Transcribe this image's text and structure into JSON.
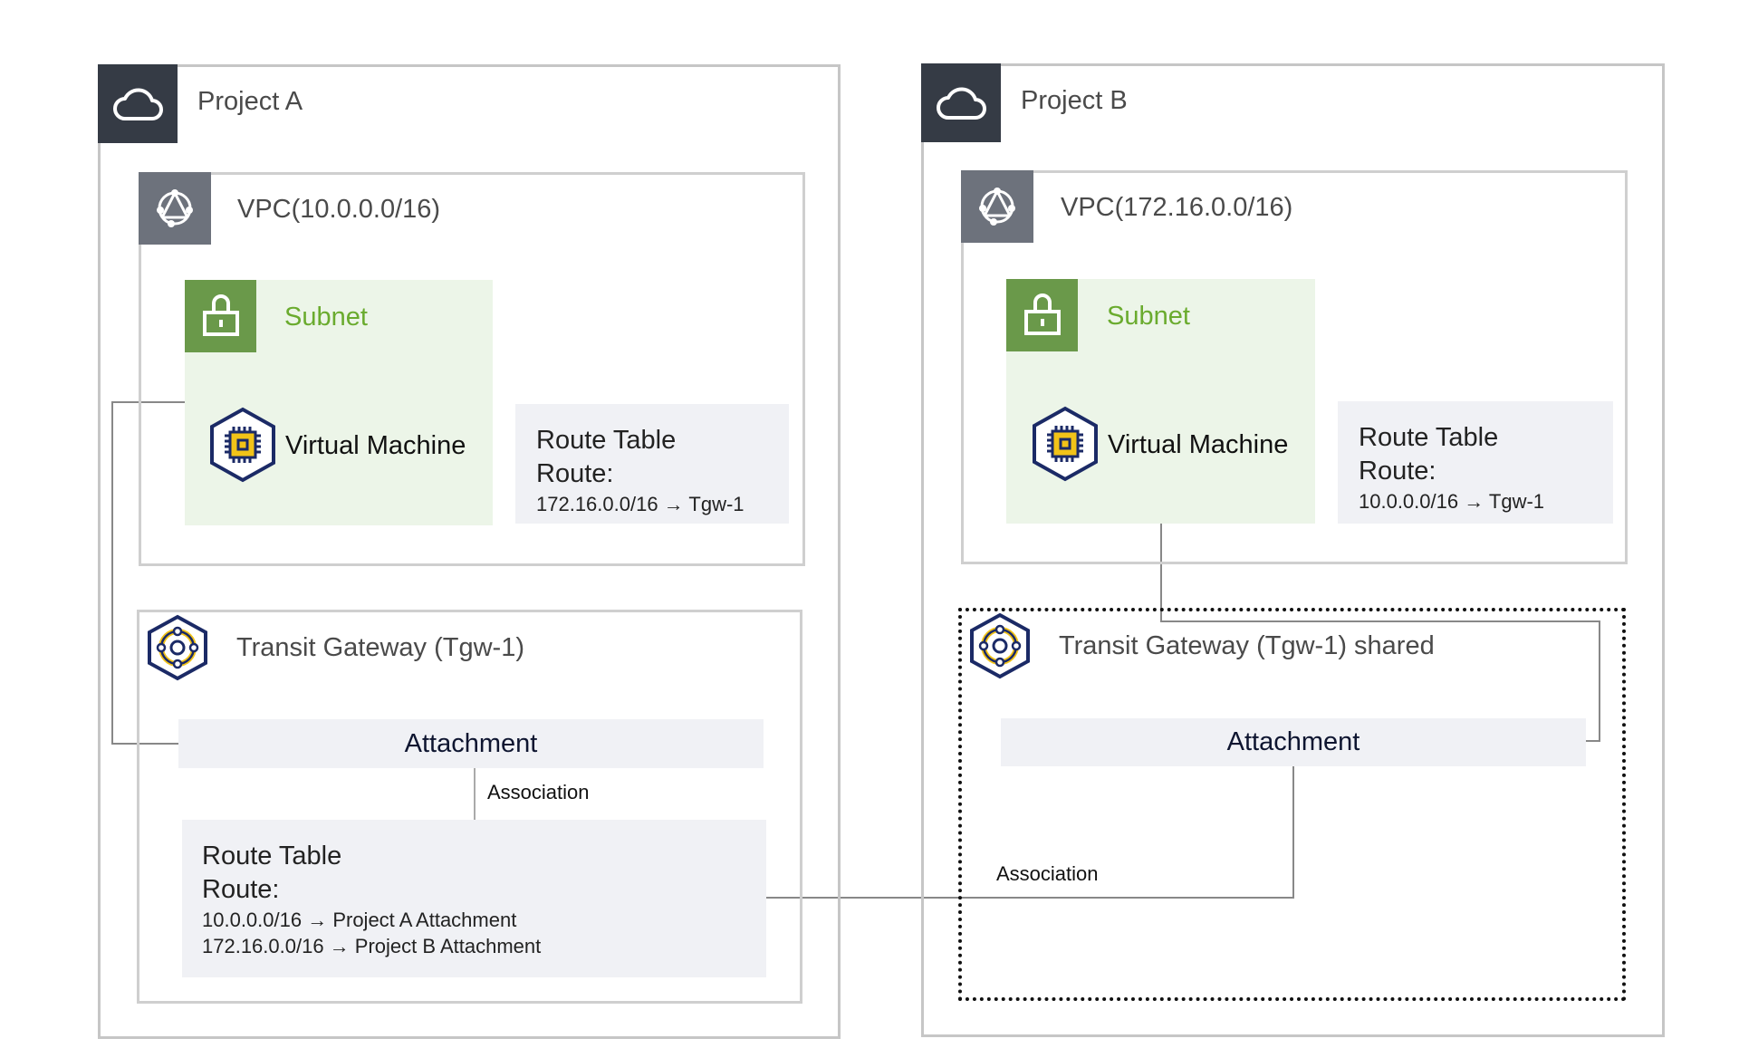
{
  "colors": {
    "header_dark": "#353b45",
    "vpc_icon_bg": "#6d727c",
    "subnet_green": "#6a994a",
    "subnet_bg": "#ecf5e8",
    "panel_bg": "#f0f1f5",
    "icon_navy": "#1b2a66",
    "icon_yellow": "#f2c318"
  },
  "project_a": {
    "title": "Project A",
    "icon": "cloud-icon",
    "vpc": {
      "title": "VPC(10.0.0.0/16)",
      "icon": "vpc-network-icon",
      "subnet": {
        "title": "Subnet",
        "icon": "lock-icon",
        "vm": {
          "label": "Virtual Machine",
          "icon": "cpu-chip-icon"
        }
      },
      "route_table": {
        "title": "Route Table",
        "route_label": "Route:",
        "routes": [
          "172.16.0.0/16 → Tgw-1"
        ]
      }
    },
    "tgw": {
      "title": "Transit Gateway (Tgw-1)",
      "icon": "transit-gateway-icon",
      "attachment": "Attachment",
      "association": "Association",
      "route_table": {
        "title": "Route Table",
        "route_label": "Route:",
        "routes": [
          "10.0.0.0/16 → Project A Attachment",
          "172.16.0.0/16 → Project B Attachment"
        ]
      }
    }
  },
  "project_b": {
    "title": "Project B",
    "icon": "cloud-icon",
    "vpc": {
      "title": "VPC(172.16.0.0/16)",
      "icon": "vpc-network-icon",
      "subnet": {
        "title": "Subnet",
        "icon": "lock-icon",
        "vm": {
          "label": "Virtual Machine",
          "icon": "cpu-chip-icon"
        }
      },
      "route_table": {
        "title": "Route Table",
        "route_label": "Route:",
        "routes": [
          "10.0.0.0/16 → Tgw-1"
        ]
      }
    },
    "tgw": {
      "title": "Transit Gateway (Tgw-1) shared",
      "icon": "transit-gateway-icon",
      "attachment": "Attachment",
      "association": "Association"
    }
  }
}
